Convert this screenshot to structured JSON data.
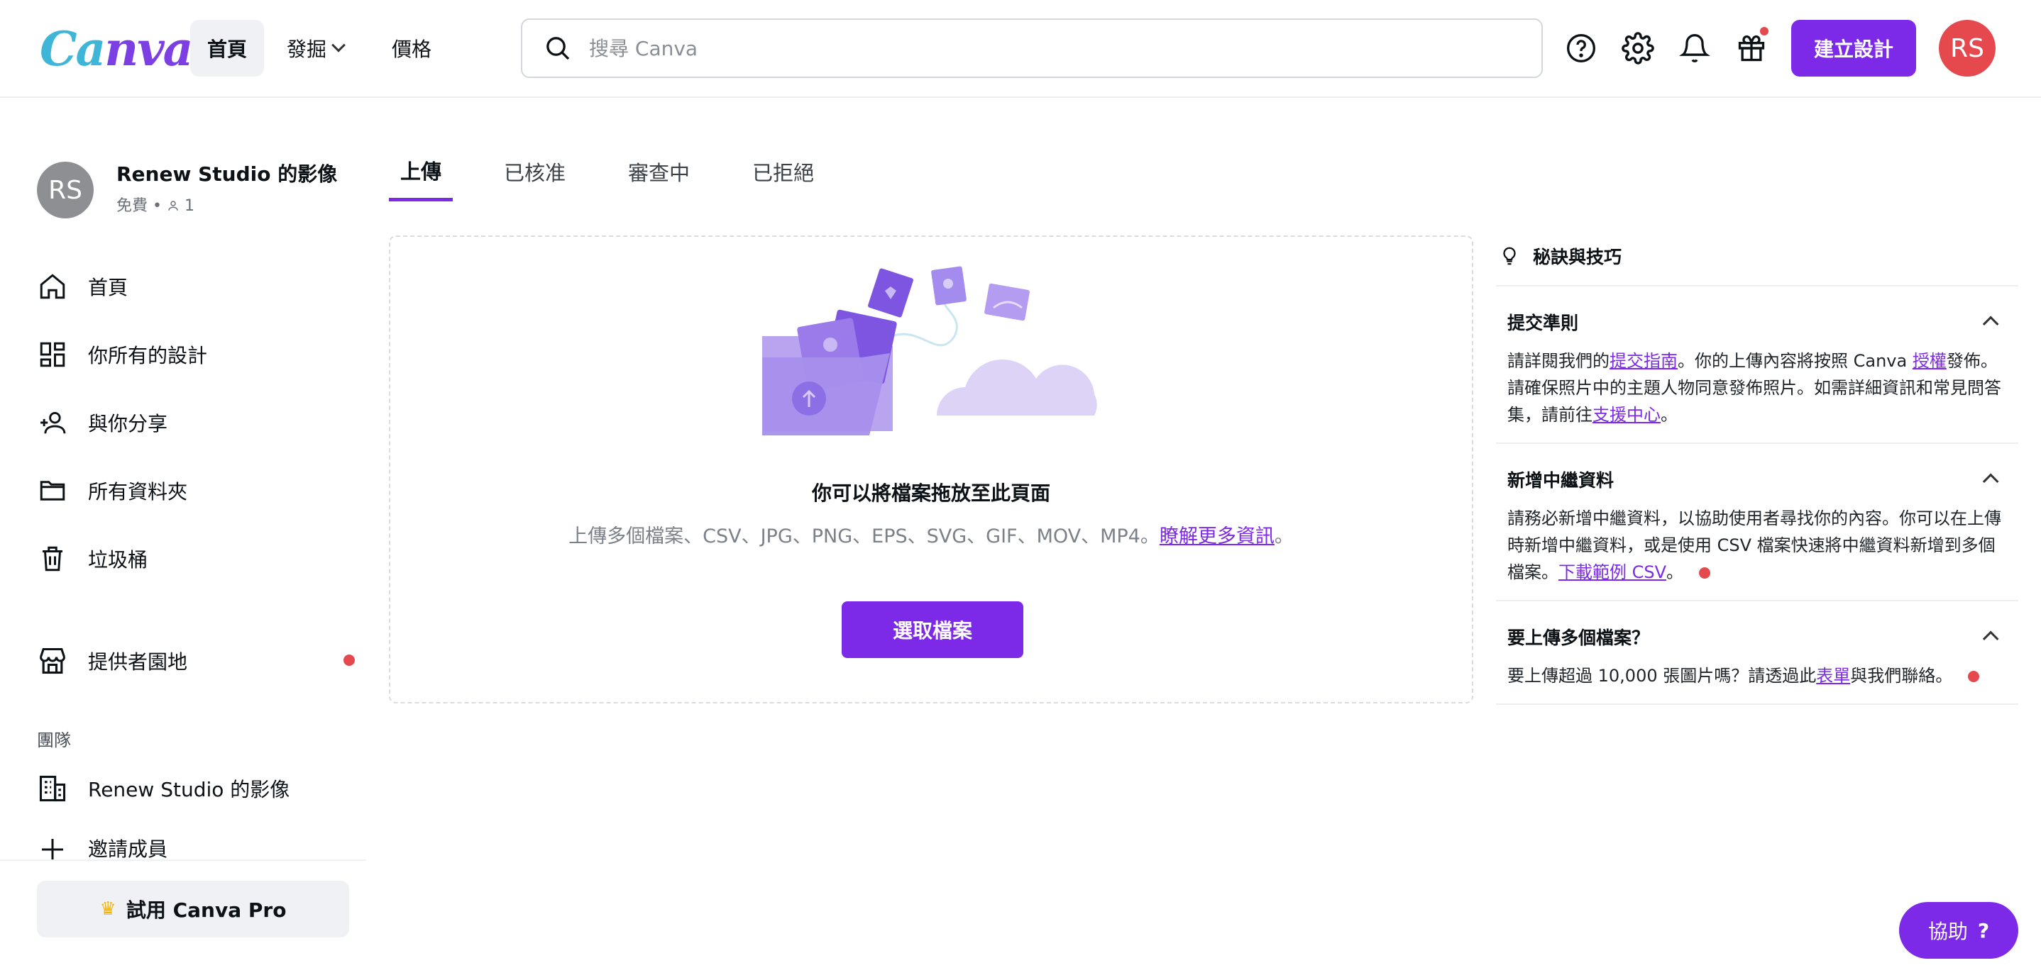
{
  "header": {
    "logo_text_a": "Ca",
    "logo_text_b": "nva",
    "nav_home": "首頁",
    "nav_discover": "發掘",
    "nav_pricing": "價格",
    "search_placeholder": "搜尋 Canva",
    "create_button": "建立設計",
    "avatar_initials": "RS"
  },
  "sidebar": {
    "profile": {
      "initials": "RS",
      "name": "Renew Studio 的影像",
      "plan": "免費",
      "member_count": "1"
    },
    "items": [
      {
        "label": "首頁",
        "icon": "home-icon"
      },
      {
        "label": "你所有的設計",
        "icon": "grid-icon"
      },
      {
        "label": "與你分享",
        "icon": "shared-users-icon"
      },
      {
        "label": "所有資料夾",
        "icon": "folder-icon"
      },
      {
        "label": "垃圾桶",
        "icon": "trash-icon"
      }
    ],
    "provider_item": {
      "label": "提供者園地",
      "icon": "store-icon"
    },
    "team_label": "團隊",
    "team_item": {
      "label": "Renew Studio 的影像",
      "icon": "building-icon"
    },
    "invite_item": {
      "label": "邀請成員",
      "icon": "plus-icon"
    },
    "try_pro": "試用 Canva Pro"
  },
  "tabs": [
    {
      "label": "上傳",
      "active": true
    },
    {
      "label": "已核准",
      "active": false
    },
    {
      "label": "審查中",
      "active": false
    },
    {
      "label": "已拒絕",
      "active": false
    }
  ],
  "upload": {
    "title": "你可以將檔案拖放至此頁面",
    "subtitle": "上傳多個檔案、CSV、JPG、PNG、EPS、SVG、GIF、MOV、MP4。",
    "learn_more": "瞭解更多資訊",
    "subtitle_end": "。",
    "select_button": "選取檔案"
  },
  "tips": {
    "heading": "秘訣與技巧",
    "sections": [
      {
        "title": "提交準則",
        "p1": "請詳閱我們的",
        "link1": "提交指南",
        "p2": "。你的上傳內容將按照 Canva ",
        "link2": "授權",
        "p3": "發佈。請確保照片中的主題人物同意發佈照片。如需詳細資訊和常見問答集，請前往",
        "link3": "支援中心",
        "p4": "。"
      },
      {
        "title": "新增中繼資料",
        "p1": "請務必新增中繼資料，以協助使用者尋找你的內容。你可以在上傳時新增中繼資料，或是使用 CSV 檔案快速將中繼資料新增到多個檔案。",
        "link1": "下載範例 CSV",
        "p2": "。"
      },
      {
        "title": "要上傳多個檔案？",
        "p1": "要上傳超過 10,000 張圖片嗎？請透過此",
        "link1": "表單",
        "p2": "與我們聯絡。"
      }
    ]
  },
  "help_button": "協助",
  "help_mark": "?",
  "colors": {
    "accent": "#7d2ae8",
    "notification": "#e5484d",
    "avatar": "#e5484d"
  }
}
